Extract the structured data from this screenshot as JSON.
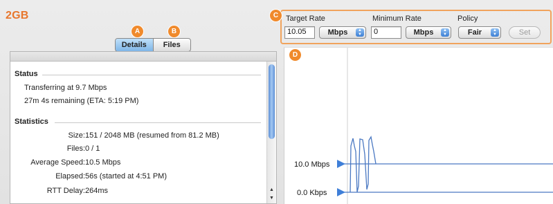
{
  "header": {
    "title": "2GB"
  },
  "callouts": {
    "a": "A",
    "b": "B",
    "c": "C",
    "d": "D"
  },
  "tabs": [
    {
      "label": "Details",
      "selected": true
    },
    {
      "label": "Files",
      "selected": false
    }
  ],
  "status": {
    "heading": "Status",
    "lines": [
      "Transferring at 9.7 Mbps",
      "27m 4s remaining (ETA: 5:19 PM)"
    ]
  },
  "statistics": {
    "heading": "Statistics",
    "rows": [
      {
        "label": "Size:",
        "value": "151 / 2048 MB (resumed from 81.2 MB)"
      },
      {
        "label": "Files:",
        "value": "0 / 1"
      },
      {
        "label": "Average Speed:",
        "value": "10.5 Mbps"
      },
      {
        "label": "Elapsed:",
        "value": "56s (started at 4:51 PM)"
      },
      {
        "label": "RTT Delay:",
        "value": "264ms"
      }
    ]
  },
  "rate_controls": {
    "target_rate_label": "Target Rate",
    "target_rate_value": "10.05",
    "target_unit": "Mbps",
    "minimum_rate_label": "Minimum Rate",
    "minimum_rate_value": "0",
    "minimum_unit": "Mbps",
    "policy_label": "Policy",
    "policy_value": "Fair",
    "set_label": "Set"
  },
  "graph": {
    "y_labels": [
      "10.0 Mbps",
      "0.0 Kbps"
    ],
    "line_color": "#4a78c2",
    "marker_color": "#3f7fd8"
  },
  "colors": {
    "accent": "#e8762c",
    "callout": "#f08a2c",
    "rate_box_border": "#f1a35c"
  },
  "icons": {
    "popup": "up-down-stepper-icon",
    "scroll_up": "scroll-up-arrow-icon",
    "scroll_down": "scroll-down-arrow-icon",
    "marker": "triangle-marker-icon"
  }
}
